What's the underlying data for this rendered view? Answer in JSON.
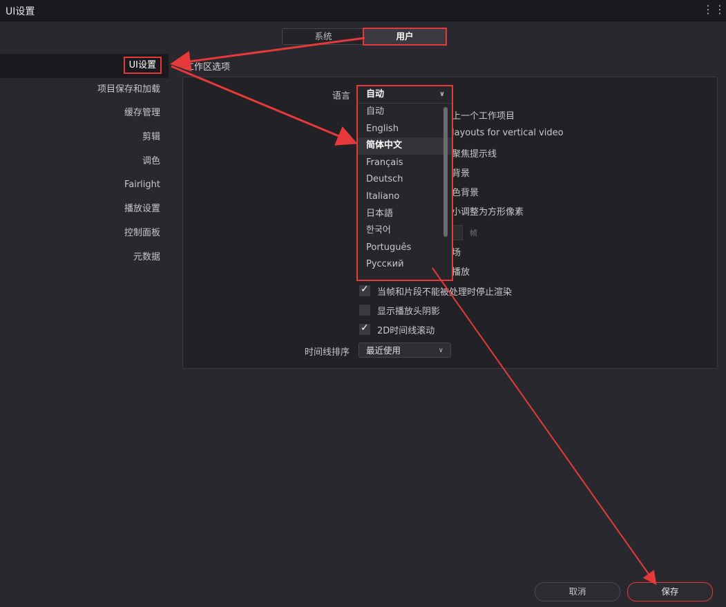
{
  "window": {
    "title": "UI设置",
    "menu": "⋮⋮"
  },
  "tabs": [
    {
      "label": "系统"
    },
    {
      "label": "用户"
    }
  ],
  "sidebar": {
    "items": [
      {
        "label": "UI设置"
      },
      {
        "label": "项目保存和加载"
      },
      {
        "label": "缓存管理"
      },
      {
        "label": "剪辑"
      },
      {
        "label": "调色"
      },
      {
        "label": "Fairlight"
      },
      {
        "label": "播放设置"
      },
      {
        "label": "控制面板"
      },
      {
        "label": "元数据"
      }
    ]
  },
  "section": {
    "title": "工作区选项"
  },
  "language": {
    "label": "语言",
    "selected": "自动",
    "options": [
      "自动",
      "English",
      "简体中文",
      "Français",
      "Deutsch",
      "Italiano",
      "日本語",
      "한국어",
      "Português",
      "Русский"
    ]
  },
  "partial_rows": {
    "r1": "上一个工作项目",
    "r2": "layouts for vertical video",
    "r3": "聚焦提示线",
    "r4": "背景",
    "r5": "色背景",
    "r6": "小调整为方形像素",
    "r6b": "帧",
    "r7": "场",
    "r8": "播放"
  },
  "options": {
    "stop_render": "当帧和片段不能被处理时停止渲染",
    "playhead_shadow": "显示播放头阴影",
    "timeline_scroll": "2D时间线滚动"
  },
  "timeline_sort": {
    "label": "时间线排序",
    "value": "最近使用"
  },
  "buttons": {
    "cancel": "取消",
    "save": "保存"
  },
  "colors": {
    "accent": "#e63a3a",
    "background": "#28282e"
  }
}
